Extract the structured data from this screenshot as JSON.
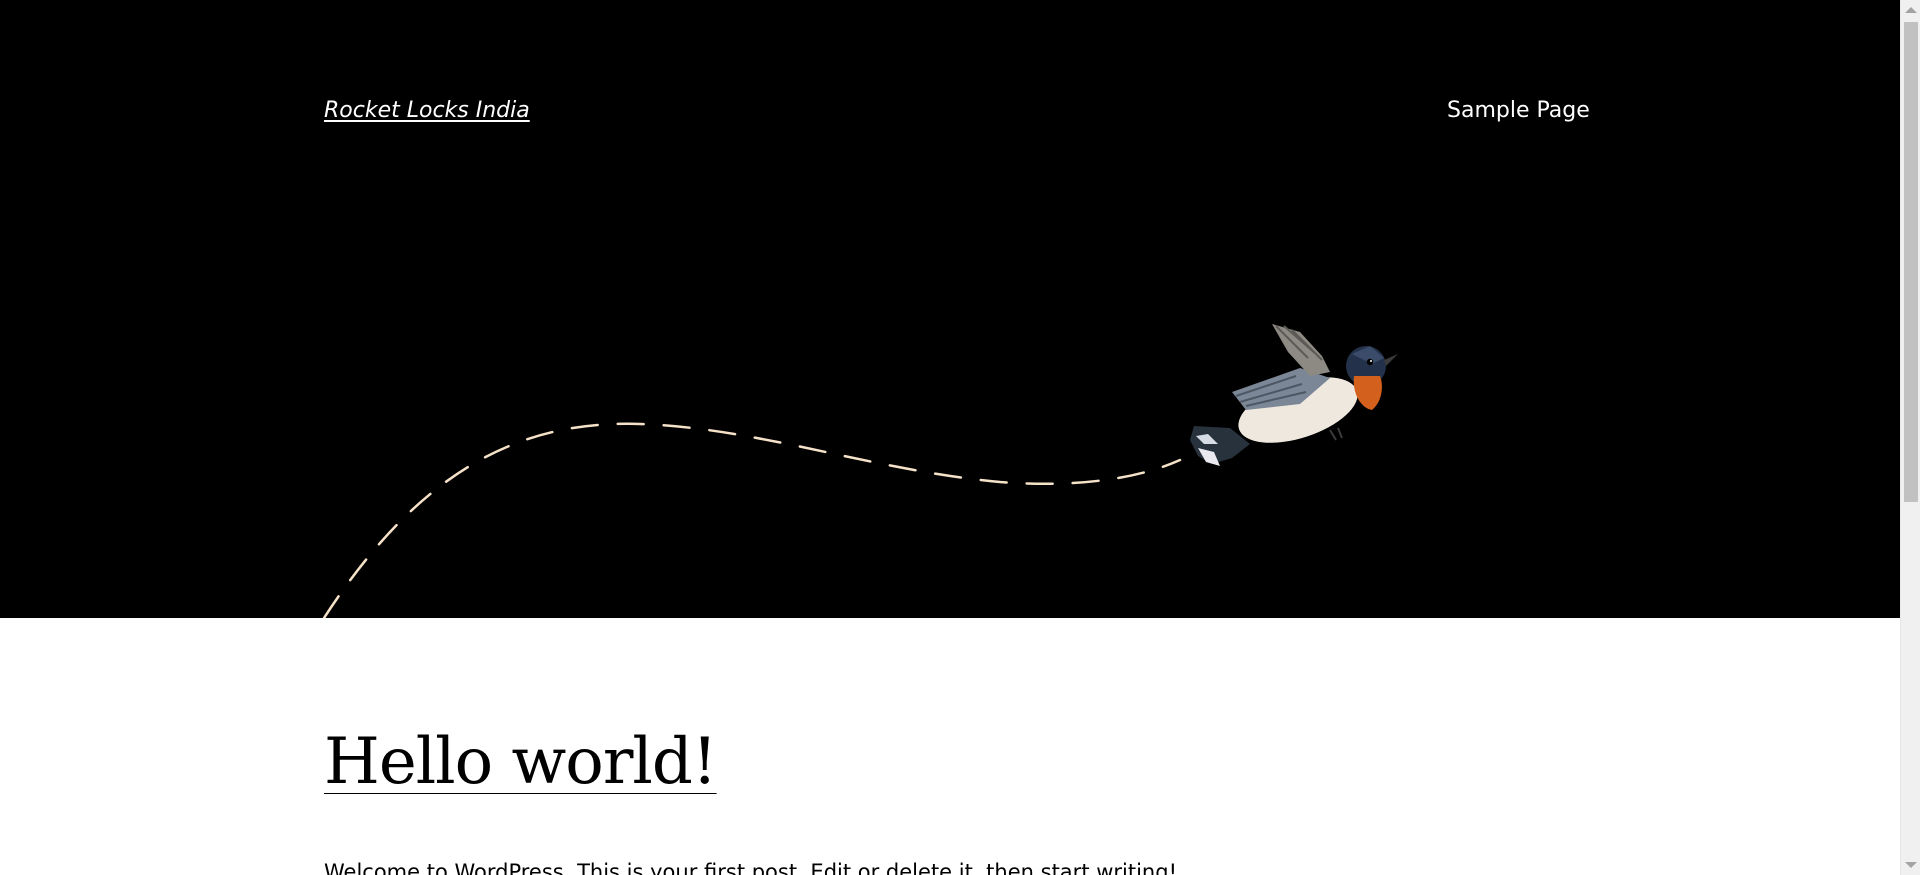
{
  "header": {
    "site_title": "Rocket Locks India",
    "nav": [
      {
        "label": "Sample Page"
      }
    ]
  },
  "hero": {
    "illustration": "bird-icon",
    "flight_path_color": "#f5e2c8",
    "background_color": "#000000"
  },
  "post": {
    "title": "Hello world!",
    "excerpt": "Welcome to WordPress. This is your first post. Edit or delete it, then start writing!"
  },
  "colors": {
    "text_on_dark": "#ffffff",
    "text_on_light": "#000000"
  }
}
